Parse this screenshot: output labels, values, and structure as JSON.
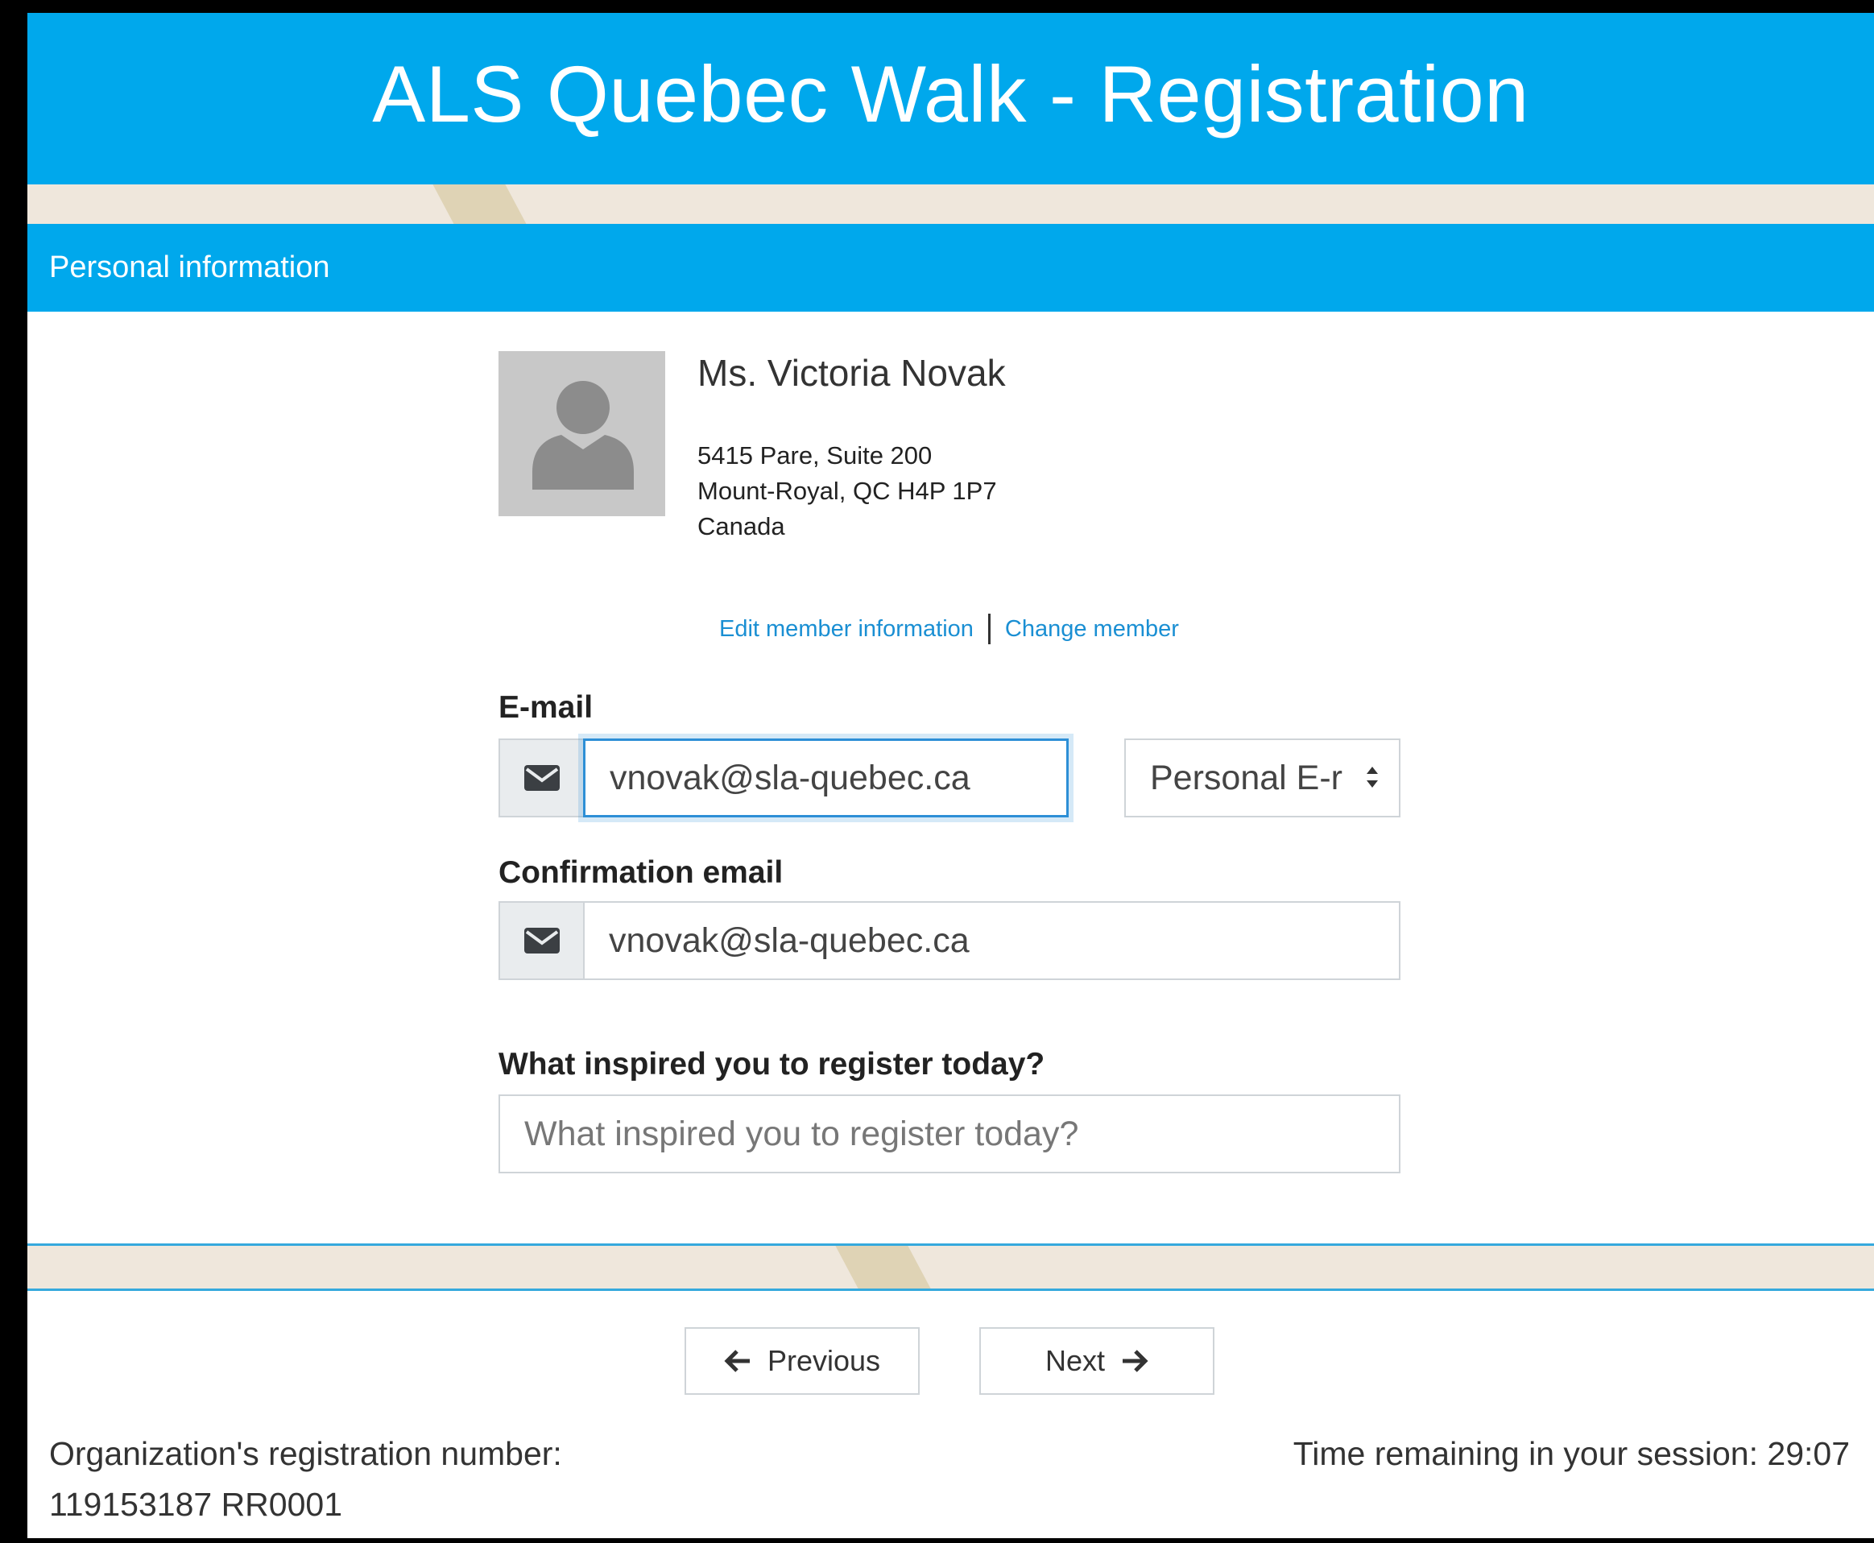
{
  "header": {
    "title": "ALS Quebec Walk - Registration"
  },
  "section": {
    "title": "Personal information"
  },
  "member": {
    "name": "Ms. Victoria Novak",
    "address_line1": "5415 Pare, Suite 200",
    "address_line2": "Mount-Royal, QC H4P 1P7",
    "address_line3": "Canada",
    "avatar_icon": "user-silhouette-icon"
  },
  "links": {
    "edit_member": "Edit member information",
    "change_member": "Change member"
  },
  "email": {
    "label": "E-mail",
    "value": "vnovak@sla-quebec.ca",
    "type_selected": "Personal E-mail",
    "type_visible": "Personal E-r",
    "icon": "envelope-icon"
  },
  "confirm_email": {
    "label": "Confirmation email",
    "value": "vnovak@sla-quebec.ca",
    "icon": "envelope-icon"
  },
  "inspiration": {
    "label": "What inspired you to register today?",
    "placeholder": "What inspired you to register today?",
    "value": ""
  },
  "buttons": {
    "previous": "Previous",
    "next": "Next"
  },
  "footer": {
    "registration_label": "Organization's registration number:",
    "registration_number": "119153187 RR0001",
    "session_label": "Time remaining in your session:",
    "session_time": "29:07"
  },
  "colors": {
    "brand_blue": "#00a8ec",
    "link_blue": "#1a8fd3",
    "stripe_beige": "#efe7dc"
  }
}
